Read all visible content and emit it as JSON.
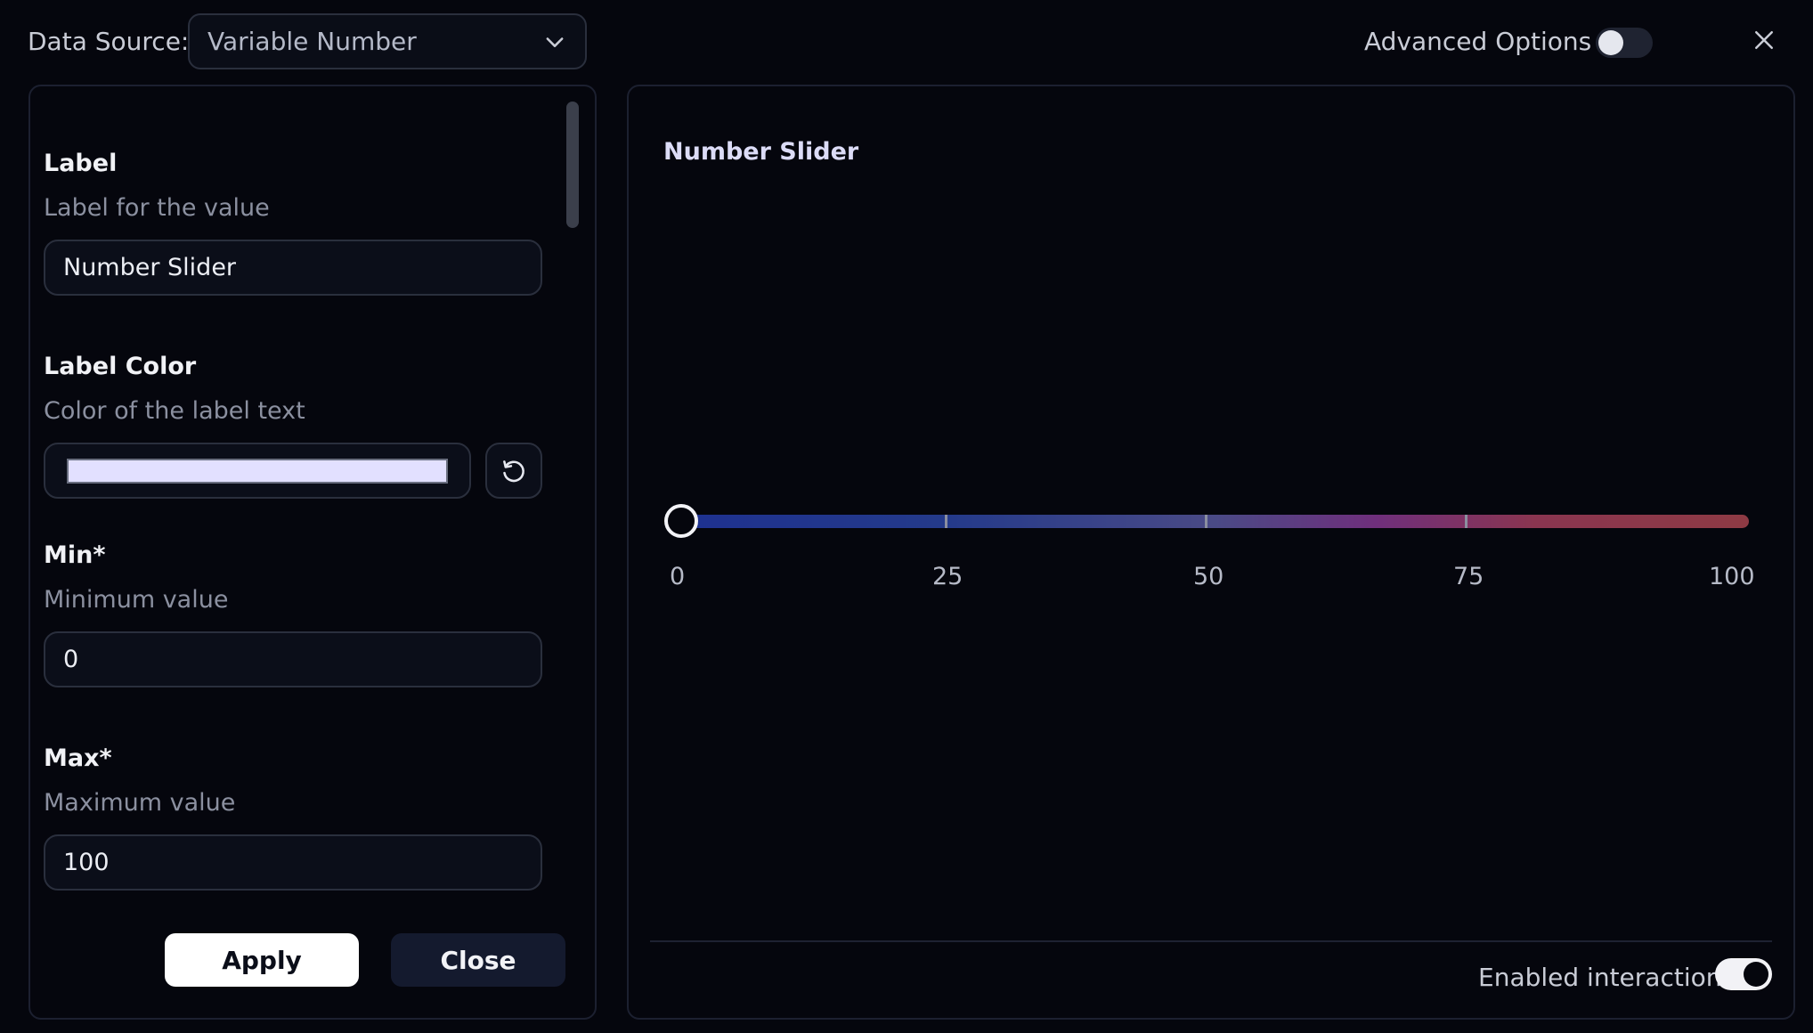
{
  "header": {
    "data_source_label": "Data Source:",
    "data_source_value": "Variable Number",
    "advanced_options_label": "Advanced Options",
    "advanced_options_enabled": false
  },
  "form": {
    "label": {
      "title": "Label",
      "description": "Label for the value",
      "value": "Number Slider"
    },
    "label_color": {
      "title": "Label Color",
      "description": "Color of the label text",
      "value": "#e2e0ff"
    },
    "min": {
      "title": "Min*",
      "description": "Minimum value",
      "value": "0"
    },
    "max": {
      "title": "Max*",
      "description": "Maximum value",
      "value": "100"
    },
    "apply_label": "Apply",
    "close_label": "Close"
  },
  "preview": {
    "title": "Number Slider",
    "slider": {
      "value": 0,
      "min": 0,
      "max": 100,
      "ticks": [
        "0",
        "25",
        "50",
        "75",
        "100"
      ]
    },
    "enabled_interactions_label": "Enabled interactions",
    "enabled_interactions": true
  },
  "icons": {
    "dropdown": "chevron-down-icon",
    "close": "close-icon",
    "reset": "reset-icon"
  }
}
